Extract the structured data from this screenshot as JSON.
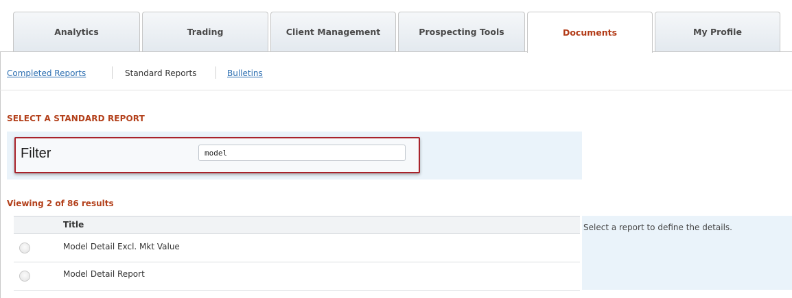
{
  "tabs": [
    {
      "label": "Analytics"
    },
    {
      "label": "Trading"
    },
    {
      "label": "Client Management"
    },
    {
      "label": "Prospecting Tools"
    },
    {
      "label": "Documents",
      "active": true
    },
    {
      "label": "My Profile"
    }
  ],
  "subnav": {
    "completed_reports": "Completed Reports",
    "standard_reports": "Standard Reports",
    "bulletins": "Bulletins"
  },
  "section_title": "SELECT A STANDARD REPORT",
  "filter": {
    "label": "Filter",
    "value": "model"
  },
  "results": {
    "count_text": "Viewing 2 of 86 results",
    "header_title": "Title",
    "rows": [
      {
        "title": "Model Detail Excl. Mkt Value"
      },
      {
        "title": "Model Detail Report"
      }
    ]
  },
  "details": {
    "hint": "Select a report to define the details."
  },
  "colors": {
    "accent": "#b3401b",
    "link": "#2a6db0",
    "highlight_border": "#a8232b",
    "panel_bg": "#eaf3fa"
  }
}
